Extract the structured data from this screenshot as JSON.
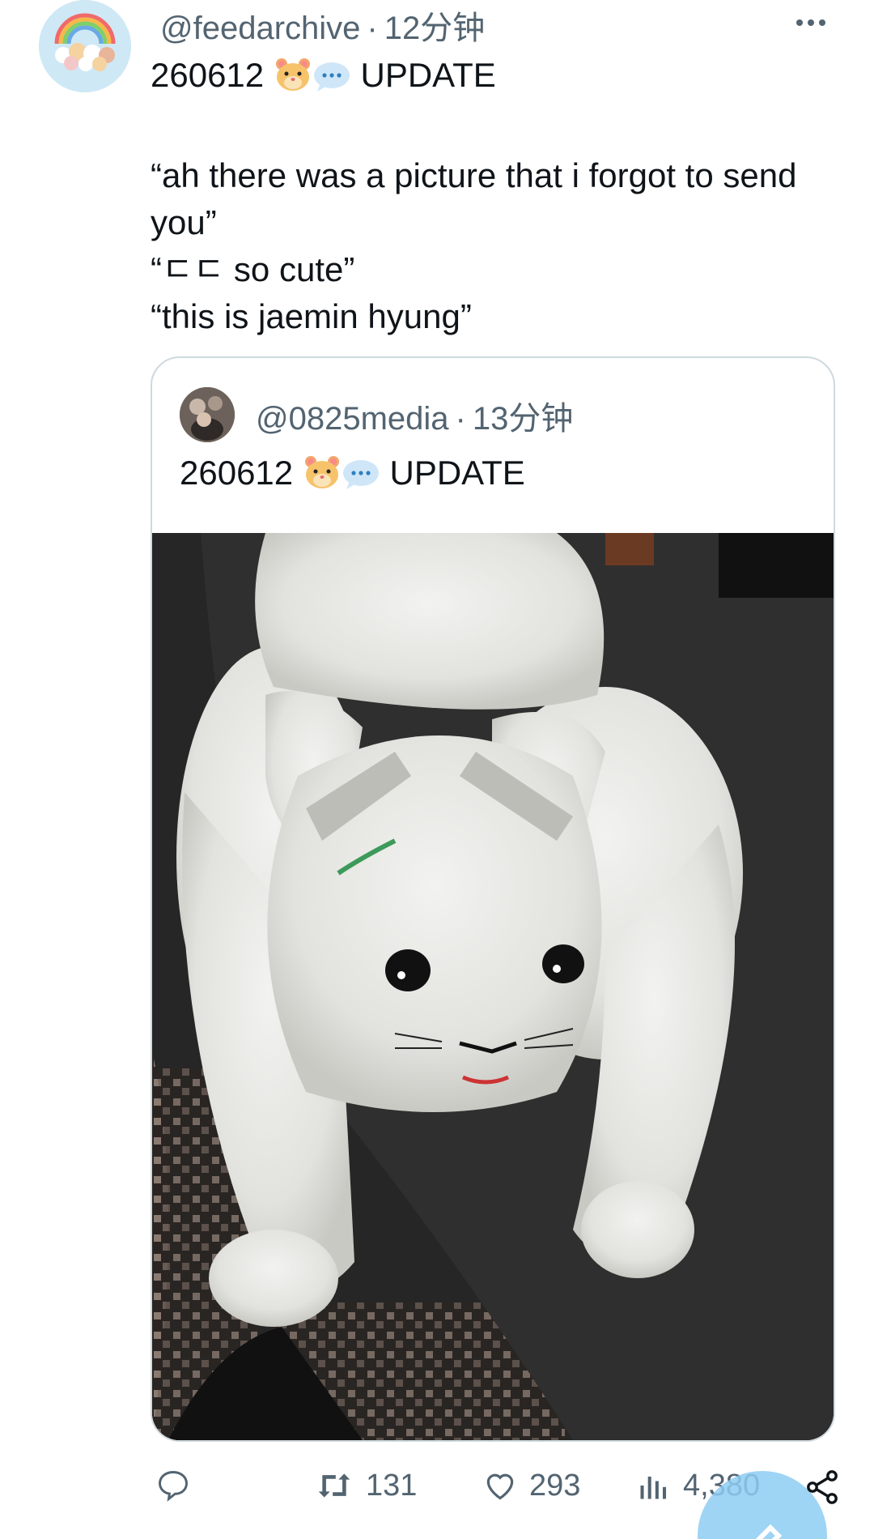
{
  "tweet": {
    "handle": "@feedarchive",
    "separator": "·",
    "time": "12分钟",
    "line1_prefix": "260612",
    "line1_suffix": "UPDATE",
    "quote1": "“ah there was a picture that i forgot to send you”",
    "quote2": "“ㄷㄷ so cute”",
    "quote3": "“this is jaemin hyung”"
  },
  "quoted": {
    "handle": "@0825media",
    "separator": "·",
    "time": "13分钟",
    "text_prefix": "260612",
    "text_suffix": "UPDATE"
  },
  "actions": {
    "retweets": "131",
    "likes": "293",
    "views": "4,380"
  },
  "colors": {
    "secondary_text": "#536471",
    "primary_text": "#0f1419",
    "border": "#cfd9de",
    "accent": "#1d9bf0"
  },
  "icons": {
    "more": "more-icon",
    "reply": "reply-icon",
    "retweet": "retweet-icon",
    "like": "heart-icon",
    "views": "views-icon",
    "share": "share-icon",
    "compose": "compose-icon"
  }
}
